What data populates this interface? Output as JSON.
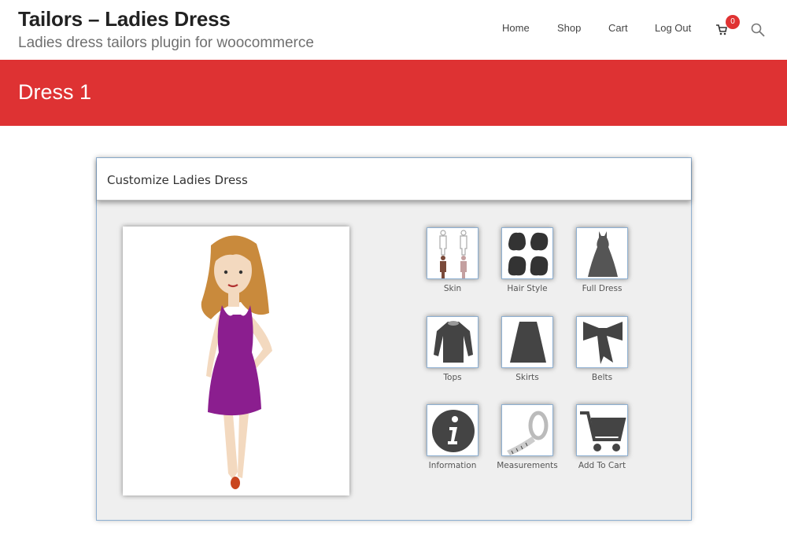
{
  "site": {
    "title": "Tailors – Ladies Dress",
    "tagline": "Ladies dress tailors plugin for woocommerce"
  },
  "nav": {
    "home": "Home",
    "shop": "Shop",
    "cart": "Cart",
    "logout": "Log Out",
    "cart_count": "0"
  },
  "banner": {
    "title": "Dress 1"
  },
  "customizer": {
    "title": "Customize Ladies Dress",
    "options": {
      "skin": "Skin",
      "hair_style": "Hair Style",
      "full_dress": "Full Dress",
      "tops": "Tops",
      "skirts": "Skirts",
      "belts": "Belts",
      "information": "Information",
      "measurements": "Measurements",
      "add_to_cart": "Add To Cart"
    }
  },
  "colors": {
    "accent": "#de3233",
    "dress": "#8b1e8f",
    "hair": "#c98a3c",
    "skin": "#f3d9bf"
  }
}
